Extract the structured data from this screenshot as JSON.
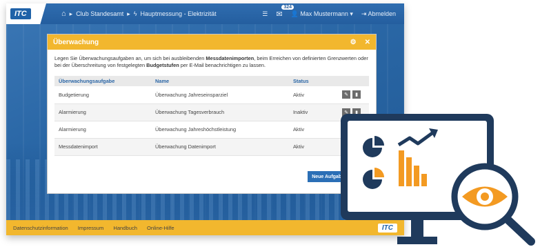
{
  "header": {
    "logo": "ITC",
    "breadcrumb": [
      "Club Standesamt",
      "Hauptmessung - Elektrizität"
    ],
    "mail_count": "324",
    "user": "Max Mustermann",
    "logout": "Abmelden"
  },
  "dialog": {
    "title": "Überwachung",
    "intro_plain_1": "Legen Sie Überwachungsaufgaben an, um sich bei ausbleibenden ",
    "intro_bold_1": "Messdatenimporten",
    "intro_plain_2": ", beim Erreichen von definierten Grenzwerten oder bei der Überschreitung von festgelegten ",
    "intro_bold_2": "Budgetstufen",
    "intro_plain_3": " per E-Mail benachrichtigen zu lassen.",
    "columns": [
      "Überwachungsaufgabe",
      "Name",
      "Status"
    ],
    "rows": [
      {
        "task": "Budgetierung",
        "name": "Überwachung Jahreseinsparziel",
        "status": "Aktiv"
      },
      {
        "task": "Alarmierung",
        "name": "Überwachung Tagesverbrauch",
        "status": "Inaktiv"
      },
      {
        "task": "Alarmierung",
        "name": "Überwachung Jahreshöchstleistung",
        "status": "Aktiv"
      },
      {
        "task": "Messdatenimport",
        "name": "Überwachung Datenimport",
        "status": "Aktiv"
      }
    ],
    "new_button": "Neue Aufgabe"
  },
  "footer": {
    "links": [
      "Datenschutzinformation",
      "Impressum",
      "Handbuch",
      "Online-Hilfe"
    ],
    "logo": "ITC"
  },
  "colors": {
    "accent_yellow": "#f2b72e",
    "brand_blue": "#245e9f",
    "illustration_navy": "#1f3a5c",
    "illustration_orange": "#f39a22"
  }
}
